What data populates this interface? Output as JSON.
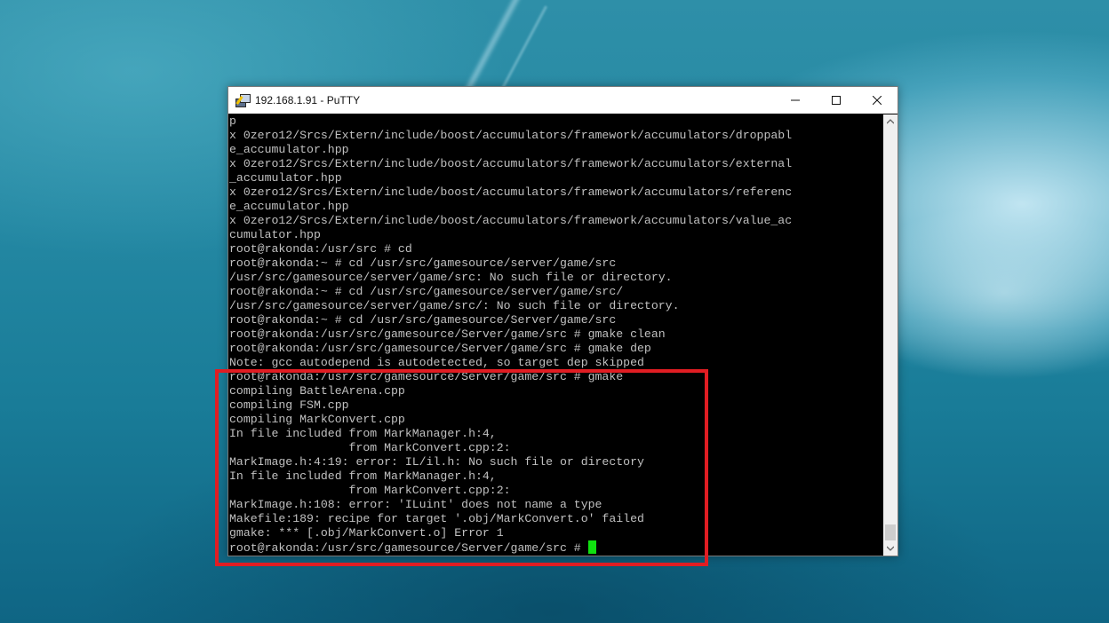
{
  "window": {
    "title": "192.168.1.91 - PuTTY",
    "buttons": {
      "minimize": "minimize",
      "maximize": "maximize",
      "close": "close"
    }
  },
  "terminal": {
    "lines": [
      "p",
      "x 0zero12/Srcs/Extern/include/boost/accumulators/framework/accumulators/droppabl",
      "e_accumulator.hpp",
      "x 0zero12/Srcs/Extern/include/boost/accumulators/framework/accumulators/external",
      "_accumulator.hpp",
      "x 0zero12/Srcs/Extern/include/boost/accumulators/framework/accumulators/referenc",
      "e_accumulator.hpp",
      "x 0zero12/Srcs/Extern/include/boost/accumulators/framework/accumulators/value_ac",
      "cumulator.hpp",
      "root@rakonda:/usr/src # cd",
      "root@rakonda:~ # cd /usr/src/gamesource/server/game/src",
      "/usr/src/gamesource/server/game/src: No such file or directory.",
      "root@rakonda:~ # cd /usr/src/gamesource/server/game/src/",
      "/usr/src/gamesource/server/game/src/: No such file or directory.",
      "root@rakonda:~ # cd /usr/src/gamesource/Server/game/src",
      "root@rakonda:/usr/src/gamesource/Server/game/src # gmake clean",
      "root@rakonda:/usr/src/gamesource/Server/game/src # gmake dep",
      "Note: gcc autodepend is autodetected, so target dep skipped",
      "root@rakonda:/usr/src/gamesource/Server/game/src # gmake",
      "compiling BattleArena.cpp",
      "compiling FSM.cpp",
      "compiling MarkConvert.cpp",
      "In file included from MarkManager.h:4,",
      "                 from MarkConvert.cpp:2:",
      "MarkImage.h:4:19: error: IL/il.h: No such file or directory",
      "In file included from MarkManager.h:4,",
      "                 from MarkConvert.cpp:2:",
      "MarkImage.h:108: error: 'ILuint' does not name a type",
      "Makefile:189: recipe for target '.obj/MarkConvert.o' failed",
      "gmake: *** [.obj/MarkConvert.o] Error 1"
    ],
    "prompt": "root@rakonda:/usr/src/gamesource/Server/game/src # ",
    "text_color": "#c0c0c0",
    "cursor_color": "#10e010"
  },
  "annotation": {
    "highlight_color": "#e11d23"
  }
}
